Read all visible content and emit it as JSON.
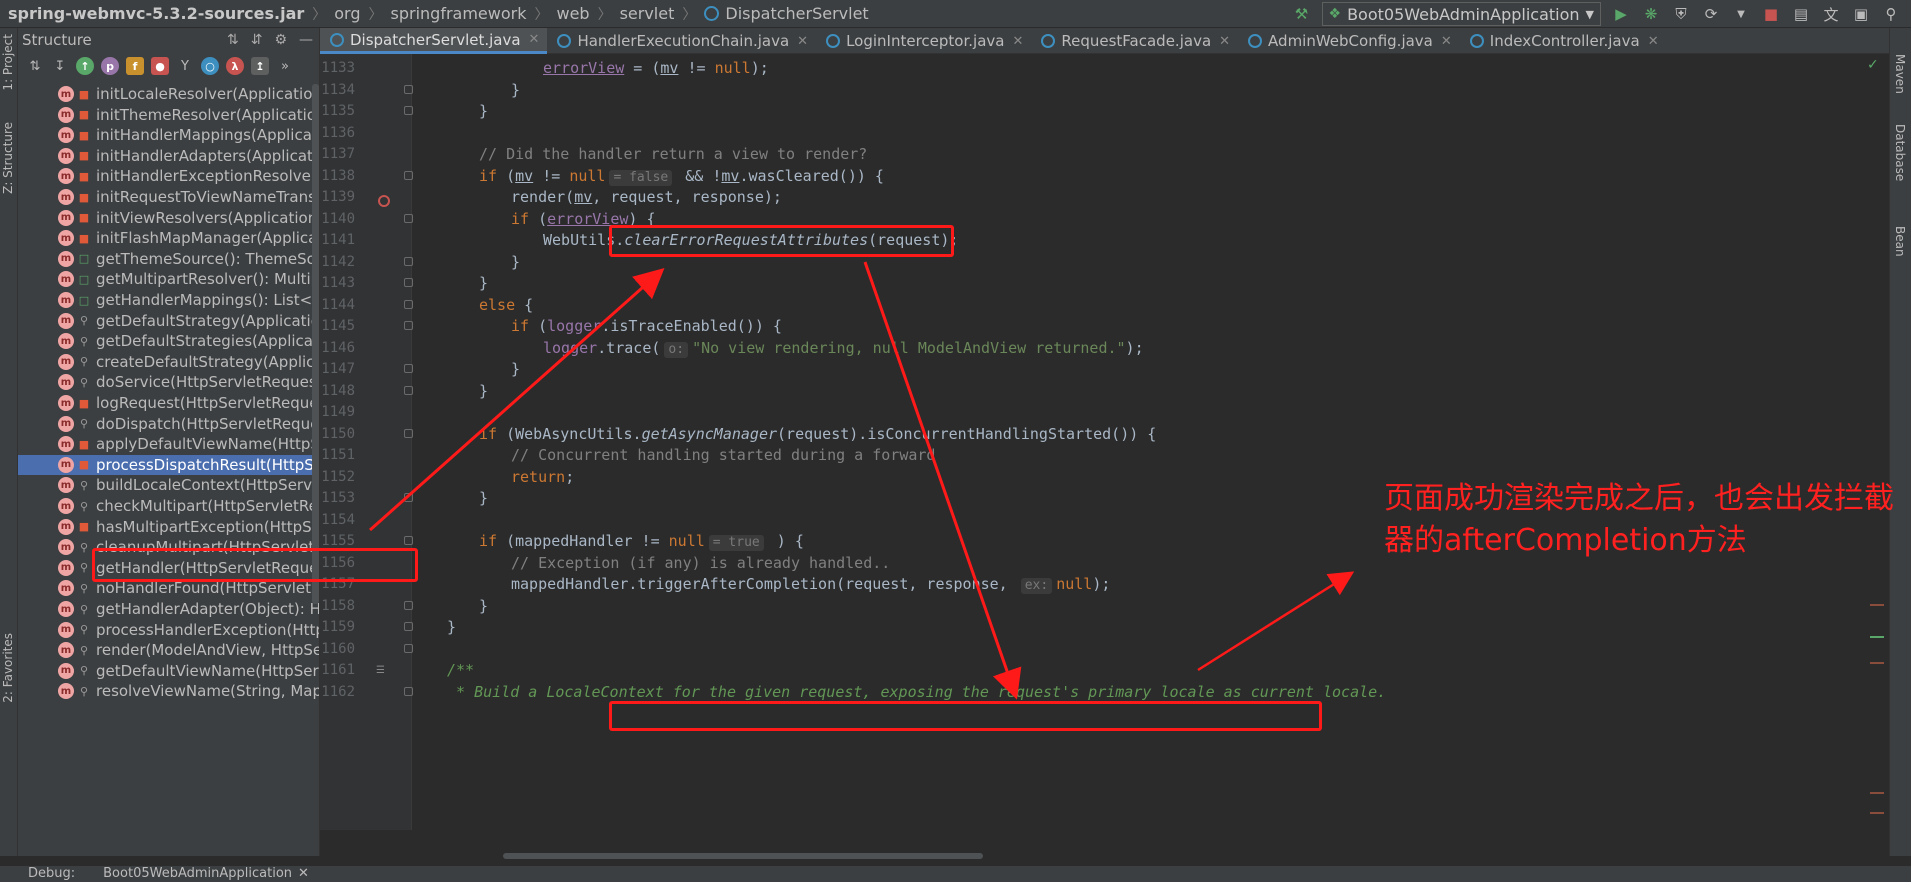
{
  "breadcrumb": [
    "spring-webmvc-5.3.2-sources.jar",
    "org",
    "springframework",
    "web",
    "servlet",
    "DispatcherServlet"
  ],
  "run_config": "Boot05WebAdminApplication",
  "left_strip": {
    "project": "1: Project",
    "structure": "Z: Structure",
    "favorites": "2: Favorites"
  },
  "right_strip": {
    "maven": "Maven",
    "database": "Database",
    "bean": "Bean"
  },
  "structure": {
    "title": "Structure",
    "items": [
      {
        "label": "initLocaleResolver(ApplicationContext",
        "vis": "lock"
      },
      {
        "label": "initThemeResolver(ApplicationContex",
        "vis": "lock"
      },
      {
        "label": "initHandlerMappings(ApplicationCont",
        "vis": "lock"
      },
      {
        "label": "initHandlerAdapters(ApplicationConte",
        "vis": "lock"
      },
      {
        "label": "initHandlerExceptionResolvers(Applica",
        "vis": "lock"
      },
      {
        "label": "initRequestToViewNameTranslator(Ap",
        "vis": "lock"
      },
      {
        "label": "initViewResolvers(ApplicationContext",
        "vis": "lock"
      },
      {
        "label": "initFlashMapManager(ApplicationCon",
        "vis": "lock"
      },
      {
        "label": "getThemeSource(): ThemeSource",
        "vis": "open"
      },
      {
        "label": "getMultipartResolver(): MultipartReso",
        "vis": "open"
      },
      {
        "label": "getHandlerMappings(): List<HandlerM",
        "vis": "open"
      },
      {
        "label": "getDefaultStrategy(ApplicationContex",
        "vis": "key"
      },
      {
        "label": "getDefaultStrategies(ApplicationConte",
        "vis": "key"
      },
      {
        "label": "createDefaultStrategy(ApplicationCon",
        "vis": "key"
      },
      {
        "label": "doService(HttpServletRequest, HttpSe",
        "vis": "key"
      },
      {
        "label": "logRequest(HttpServletRequest): void",
        "vis": "lock"
      },
      {
        "label": "doDispatch(HttpServletRequest, Http",
        "vis": "key"
      },
      {
        "label": "applyDefaultViewName(HttpServletRe",
        "vis": "lock"
      },
      {
        "label": "processDispatchResult(HttpServletRec",
        "vis": "lock",
        "selected": true
      },
      {
        "label": "buildLocaleContext(HttpServletReque",
        "vis": "key"
      },
      {
        "label": "checkMultipart(HttpServletRequest): H",
        "vis": "key"
      },
      {
        "label": "hasMultipartException(HttpServletRec",
        "vis": "lock"
      },
      {
        "label": "cleanupMultipart(HttpServletRequest)",
        "vis": "key"
      },
      {
        "label": "getHandler(HttpServletRequest): Hand",
        "vis": "key"
      },
      {
        "label": "noHandlerFound(HttpServletRequest,",
        "vis": "key"
      },
      {
        "label": "getHandlerAdapter(Object): HandlerA",
        "vis": "key"
      },
      {
        "label": "processHandlerException(HttpServlet",
        "vis": "key"
      },
      {
        "label": "render(ModelAndView, HttpServletRe",
        "vis": "key"
      },
      {
        "label": "getDefaultViewName(HttpServletRequ",
        "vis": "key"
      },
      {
        "label": "resolveViewName(String, Map<String",
        "vis": "key"
      }
    ]
  },
  "tabs": [
    {
      "label": "DispatcherServlet.java",
      "active": true
    },
    {
      "label": "HandlerExecutionChain.java"
    },
    {
      "label": "LoginInterceptor.java"
    },
    {
      "label": "RequestFacade.java"
    },
    {
      "label": "AdminWebConfig.java"
    },
    {
      "label": "IndexController.java"
    }
  ],
  "code_lines": [
    {
      "n": "1133",
      "t1": "errorView",
      "t2": " = (",
      "t3": "mv",
      "t4": " != ",
      "t5": "null",
      "t6": ");"
    },
    {
      "n": "1134",
      "text": "}"
    },
    {
      "n": "1135",
      "text": "}"
    },
    {
      "n": "1136",
      "text": ""
    },
    {
      "n": "1137",
      "comment": "// Did the handler return a view to render?"
    },
    {
      "n": "1138",
      "a": "if",
      "b": " (",
      "c": "mv",
      "d": " != ",
      "e": "null",
      "hint": "= false",
      "f": " && !",
      "g": "mv",
      "h": ".wasCleared()) {"
    },
    {
      "n": "1139",
      "a": "render(",
      "b": "mv",
      "c": ", request, response);"
    },
    {
      "n": "1140",
      "a": "if",
      "b": " (",
      "c": "errorView",
      "d": ") {"
    },
    {
      "n": "1141",
      "a": "WebUtils.",
      "b": "clearErrorRequestAttributes",
      "c": "(request);"
    },
    {
      "n": "1142",
      "text": "}"
    },
    {
      "n": "1143",
      "text": "}"
    },
    {
      "n": "1144",
      "a": "else",
      "b": " {"
    },
    {
      "n": "1145",
      "a": "if",
      "b": " (",
      "c": "logger",
      "d": ".isTraceEnabled()) {"
    },
    {
      "n": "1146",
      "a": "logger",
      "b": ".trace(",
      "hint": "o:",
      "s": "\"No view rendering, null ModelAndView returned.\"",
      "c": ");"
    },
    {
      "n": "1147",
      "text": "}"
    },
    {
      "n": "1148",
      "text": "}"
    },
    {
      "n": "1149",
      "text": ""
    },
    {
      "n": "1150",
      "a": "if",
      "b": " (WebAsyncUtils.",
      "c": "getAsyncManager",
      "d": "(request).isConcurrentHandlingStarted()) {"
    },
    {
      "n": "1151",
      "comment": "// Concurrent handling started during a forward"
    },
    {
      "n": "1152",
      "a": "return",
      "b": ";"
    },
    {
      "n": "1153",
      "text": "}"
    },
    {
      "n": "1154",
      "text": ""
    },
    {
      "n": "1155",
      "a": "if",
      "b": " (mappedHandler != ",
      "c": "null",
      "hint": "= true",
      "d": " ) {"
    },
    {
      "n": "1156",
      "comment": "// Exception (if any) is already handled.."
    },
    {
      "n": "1157",
      "a": "mappedHandler.triggerAfterCompletion(request, response, ",
      "hint": "ex:",
      "c": "null",
      "d": ");"
    },
    {
      "n": "1158",
      "text": "}"
    },
    {
      "n": "1159",
      "text": "}"
    },
    {
      "n": "1160",
      "text": ""
    },
    {
      "n": "1161",
      "doc": "/**"
    },
    {
      "n": "1162",
      "doc": " * Build a LocaleContext for the given request, exposing the request's primary locale as current locale."
    }
  ],
  "annotation": {
    "text": "页面成功渲染完成之后，也会出发拦截器的afterCompletion方法",
    "color": "#ff1a1a"
  },
  "status": {
    "debug": "Debug:",
    "app": "Boot05WebAdminApplication"
  }
}
